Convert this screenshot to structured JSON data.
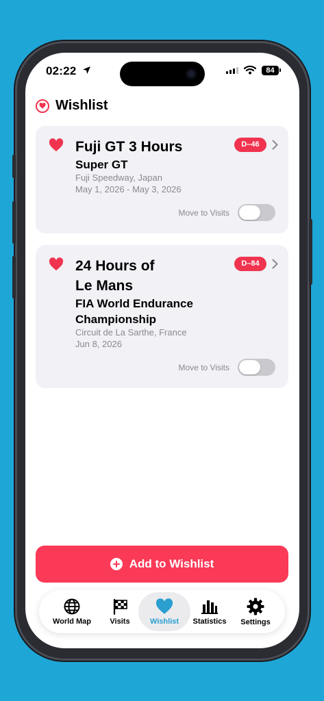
{
  "status_bar": {
    "time": "02:22",
    "battery": "84"
  },
  "header": {
    "title": "Wishlist"
  },
  "events": [
    {
      "title_line1": "Fuji GT 3 Hours",
      "title_line2": "",
      "series_line1": "Super GT",
      "series_line2": "",
      "venue": "Fuji Speedway, Japan",
      "dates": "May 1, 2026 - May 3, 2026",
      "countdown": "D–46",
      "move_label": "Move to Visits",
      "move_enabled": false
    },
    {
      "title_line1": "24 Hours of",
      "title_line2": "Le Mans",
      "series_line1": "FIA World Endurance",
      "series_line2": "Championship",
      "venue": "Circuit de La Sarthe, France",
      "dates": "Jun 8, 2026",
      "countdown": "D–84",
      "move_label": "Move to Visits",
      "move_enabled": false
    }
  ],
  "add_button": {
    "label": "Add to Wishlist"
  },
  "tabs": [
    {
      "label": "World Map",
      "icon": "globe-icon"
    },
    {
      "label": "Visits",
      "icon": "checkered-flag-icon"
    },
    {
      "label": "Wishlist",
      "icon": "heart-icon",
      "active": true
    },
    {
      "label": "Statistics",
      "icon": "bar-chart-icon"
    },
    {
      "label": "Settings",
      "icon": "gear-icon"
    }
  ],
  "colors": {
    "accent_red": "#fb3a58",
    "heart_red": "#f0344f",
    "active_tab": "#2a9fd0",
    "background": "#1ea6d6"
  }
}
